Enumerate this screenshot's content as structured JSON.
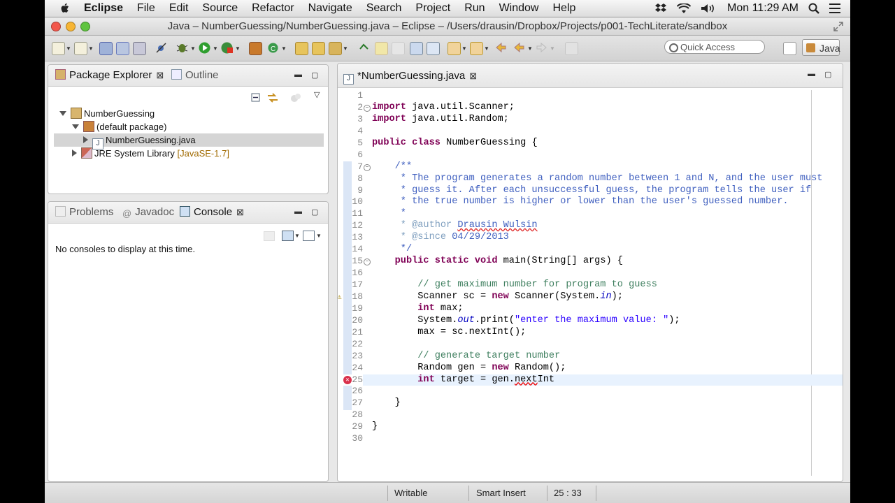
{
  "menubar": {
    "app": "Eclipse",
    "items": [
      "File",
      "Edit",
      "Source",
      "Refactor",
      "Navigate",
      "Search",
      "Project",
      "Run",
      "Window",
      "Help"
    ],
    "clock": "Mon 11:29 AM"
  },
  "window": {
    "title": "Java – NumberGuessing/NumberGuessing.java – Eclipse – /Users/drausin/Dropbox/Projects/p001-TechLiterate/sandbox"
  },
  "toolbar": {
    "quick_access_placeholder": "Quick Access",
    "perspective": "Java"
  },
  "package_explorer": {
    "tab_label": "Package Explorer",
    "outline_label": "Outline",
    "tree": {
      "project": "NumberGuessing",
      "package": "(default package)",
      "file": "NumberGuessing.java",
      "library": "JRE System Library",
      "library_version": "[JavaSE-1.7]"
    }
  },
  "bottom_panel": {
    "tabs": [
      "Problems",
      "Javadoc",
      "Console"
    ],
    "message": "No consoles to display at this time."
  },
  "editor": {
    "tab_label": "*NumberGuessing.java",
    "line_numbers": [
      "1",
      "2",
      "3",
      "4",
      "5",
      "6",
      "7",
      "8",
      "9",
      "10",
      "11",
      "12",
      "13",
      "14",
      "15",
      "16",
      "17",
      "18",
      "19",
      "20",
      "21",
      "22",
      "23",
      "24",
      "25",
      "26",
      "27",
      "28",
      "29",
      "30"
    ],
    "code": {
      "l2_kw": "import",
      "l2_rest": " java.util.Scanner;",
      "l3_kw": "import",
      "l3_rest": " java.util.Random;",
      "l5_kw1": "public",
      "l5_kw2": "class",
      "l5_rest": " NumberGuessing {",
      "l7": "    /**",
      "l8": "     * The program generates a random number between 1 and N, and the user must",
      "l9": "     * guess it. After each unsuccessful guess, the program tells the user if",
      "l10": "     * the true number is higher or lower than the user's guessed number.",
      "l11": "     *",
      "l12_pre": "     * @author ",
      "l12_name": "Drausin Wulsin",
      "l13_pre": "     * @since ",
      "l13_val": "04/29/2013",
      "l14": "     */",
      "l15_kw": "public static void",
      "l15_rest": " main(String[] args) {",
      "l17": "        // get maximum number for program to guess",
      "l18_a": "        Scanner sc = ",
      "l18_kw": "new",
      "l18_b": " Scanner(System.",
      "l18_it": "in",
      "l18_c": ");",
      "l19_kw": "int",
      "l19_rest": " max;",
      "l20_a": "        System.",
      "l20_it": "out",
      "l20_b": ".print(",
      "l20_str": "\"enter the maximum value: \"",
      "l20_c": ");",
      "l21": "        max = sc.nextInt();",
      "l23": "        // generate target number",
      "l24_a": "        Random gen = ",
      "l24_kw": "new",
      "l24_b": " Random();",
      "l25_kw": "int",
      "l25_a": " target = gen.",
      "l25_err": "next",
      "l25_b": "Int",
      "l27": "    }",
      "l29": "}"
    }
  },
  "status": {
    "writable": "Writable",
    "insert_mode": "Smart Insert",
    "position": "25 : 33"
  },
  "colors": {
    "keyword": "#7f0055",
    "comment": "#3f7f5f",
    "javadoc": "#3f5fbf",
    "string": "#2a00ff",
    "error": "#e00000"
  }
}
